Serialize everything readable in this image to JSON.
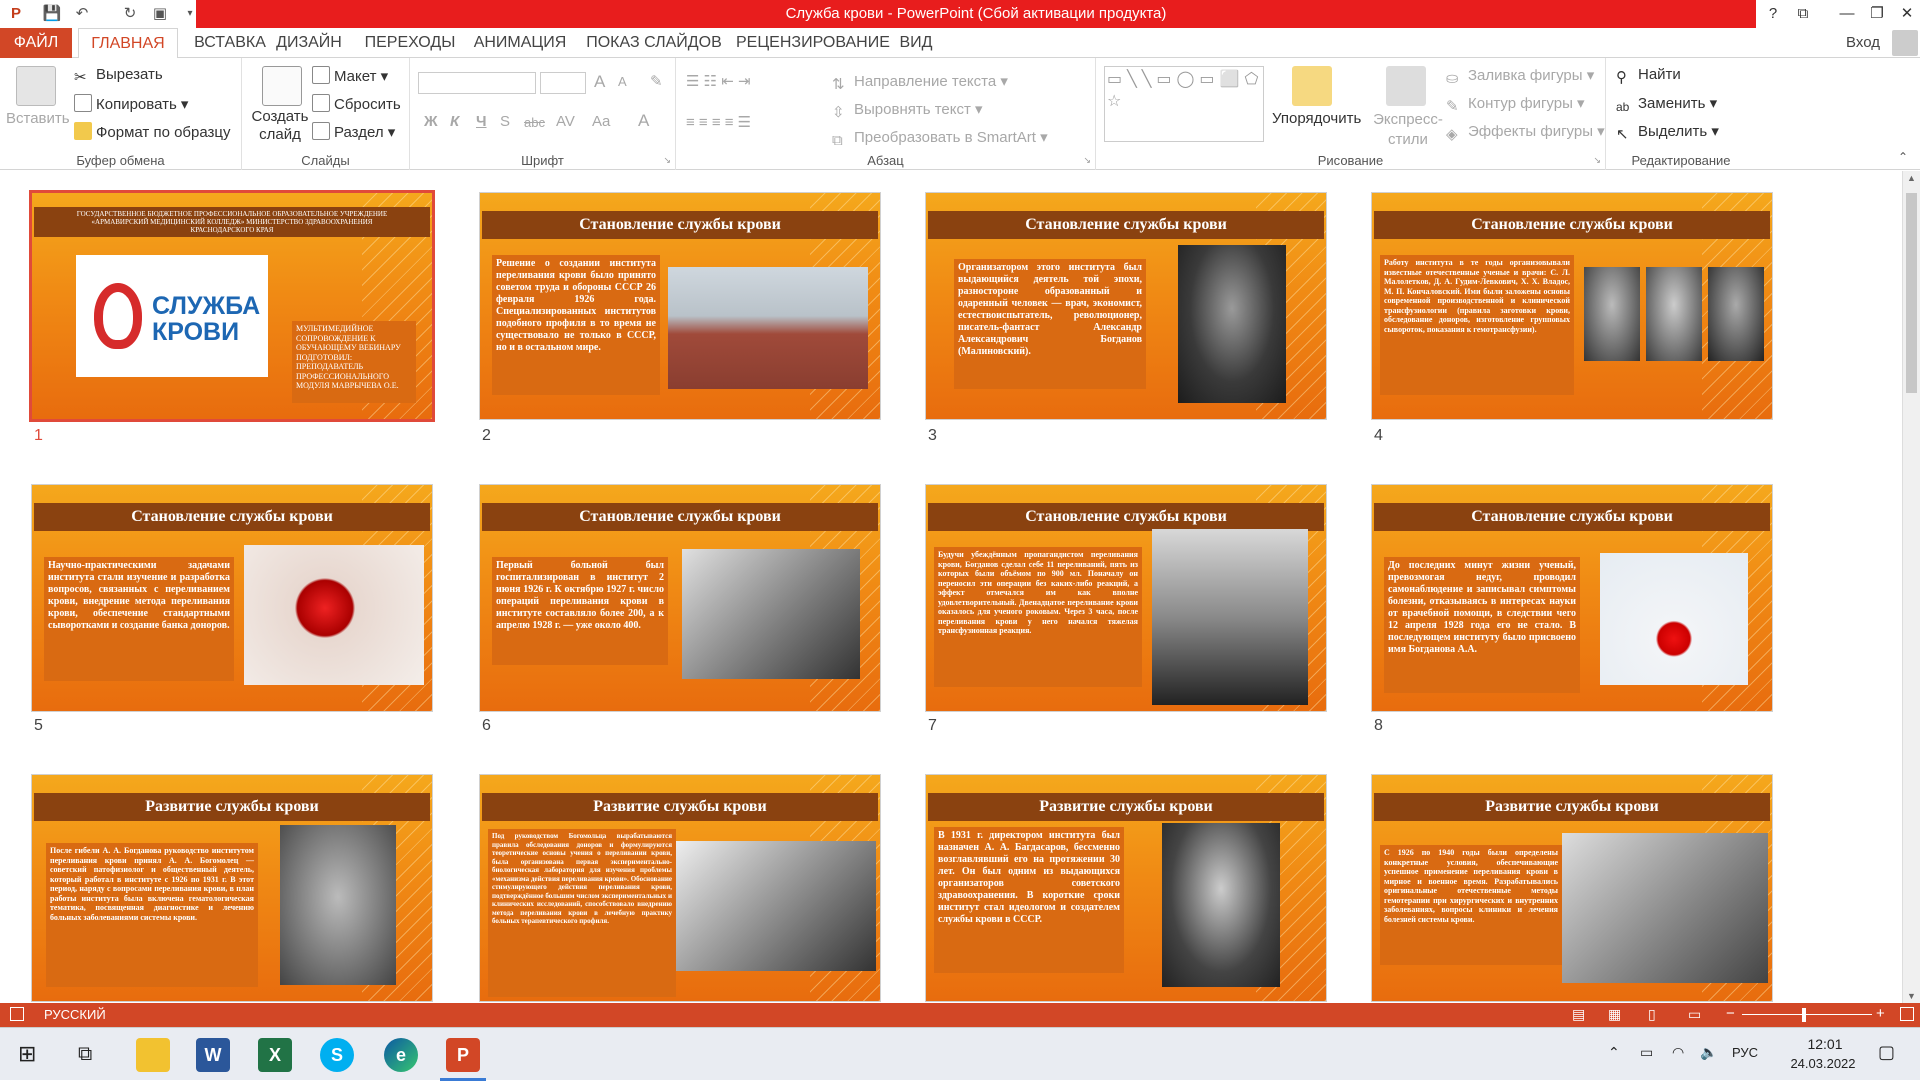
{
  "window": {
    "title": "Служба крови -  PowerPoint (Сбой активации продукта)",
    "help": "?",
    "user": "Вход"
  },
  "tabs": [
    {
      "label": "ФАЙЛ"
    },
    {
      "label": "ГЛАВНАЯ"
    },
    {
      "label": "ВСТАВКА"
    },
    {
      "label": "ДИЗАЙН"
    },
    {
      "label": "ПЕРЕХОДЫ"
    },
    {
      "label": "АНИМАЦИЯ"
    },
    {
      "label": "ПОКАЗ СЛАЙДОВ"
    },
    {
      "label": "РЕЦЕНЗИРОВАНИЕ"
    },
    {
      "label": "ВИД"
    }
  ],
  "ribbon": {
    "clipboard": {
      "label": "Буфер обмена",
      "paste": "Вставить",
      "cut": "Вырезать",
      "copy": "Копировать",
      "format_painter": "Формат по образцу"
    },
    "slides": {
      "label": "Слайды",
      "new_slide": "Создать слайд",
      "layout": "Макет",
      "reset": "Сбросить",
      "section": "Раздел"
    },
    "font": {
      "label": "Шрифт",
      "bold": "Ж",
      "italic": "К",
      "underline": "Ч",
      "shadow": "S",
      "strike": "abc",
      "spacing": "AV",
      "case": "Aa",
      "color": "A",
      "grow": "A",
      "shrink": "A"
    },
    "paragraph": {
      "label": "Абзац",
      "text_direction": "Направление текста",
      "align_text": "Выровнять текст",
      "smartart": "Преобразовать в SmartArt"
    },
    "drawing": {
      "label": "Рисование",
      "arrange": "Упорядочить",
      "quick_styles": "Экспресс-стили",
      "fill": "Заливка фигуры",
      "outline": "Контур фигуры",
      "effects": "Эффекты фигуры"
    },
    "editing": {
      "label": "Редактирование",
      "find": "Найти",
      "replace": "Заменить",
      "select": "Выделить"
    }
  },
  "slides": [
    {
      "num": "1",
      "title": "",
      "org": "ГОСУДАРСТВЕННОЕ БЮДЖЕТНОЕ ПРОФЕССИОНАЛЬНОЕ ОБРАЗОВАТЕЛЬНОЕ УЧРЕЖДЕНИЕ «АРМАВИРСКИЙ МЕДИЦИНСКИЙ КОЛЛЕДЖ» МИНИСТЕРСТВО ЗДРАВООХРАНЕНИЯ КРАСНОДАРСКОГО КРАЯ",
      "logo_line1": "СЛУЖБА",
      "logo_line2": "КРОВИ",
      "text": "МУЛЬТИМЕДИЙНОЕ СОПРОВОЖДЕНИЕ К ОБУЧАЮЩЕМУ ВЕБИНАРУ ПОДГОТОВИЛ: ПРЕПОДАВАТЕЛЬ ПРОФЕССИОНАЛЬНОГО МОДУЛЯ МАВРЫЧЕВА О.Е."
    },
    {
      "num": "2",
      "title": "Становление службы крови",
      "text": "Решение о создании института переливания крови было принято советом труда и обороны СССР 26 февраля 1926 года. Специализированных институтов подобного профиля в то время не существовало не только в СССР, но и в остальном мире."
    },
    {
      "num": "3",
      "title": "Становление службы крови",
      "text": "Организатором этого института был выдающийся деятель той эпохи, разностороне образованный и одаренный человек — врач, экономист, естествоиспытатель, революционер, писатель-фантаст Александр Александрович Богданов (Малиновский)."
    },
    {
      "num": "4",
      "title": "Становление службы крови",
      "text": "Работу института в те годы организовывали известные отечественные ученые и врачи: С. Л. Малолетков, Д. А. Гудим-Левкович, Х. Х. Владос, М. П. Кончаловский. Ими были заложены основы современной производственной и клинической трансфузиологии (правила заготовки крови, обследование доноров, изготовление групповых сывороток, показания к гемотрансфузии)."
    },
    {
      "num": "5",
      "title": "Становление службы крови",
      "text": "Научно-практическими задачами института стали изучение и разработка вопросов, связанных с переливанием крови, внедрение метода переливания крови, обеспечение стандартными сыворотками и создание банка доноров."
    },
    {
      "num": "6",
      "title": "Становление службы крови",
      "text": "Первый больной был госпитализирован в институт 2 июня 1926 г. К октябрю 1927 г. число операций переливания крови в институте составляло более 200, а к апрелю 1928 г. — уже около 400."
    },
    {
      "num": "7",
      "title": "Становление службы крови",
      "text": "Будучи убеждённым пропагандистом переливания крови, Богданов сделал себе 11 переливаний, пять из которых были объёмом по 900 мл. Поначалу он переносил эти операции без каких-либо реакций, а эффект отмечался им как вполне удовлетворительный. Двенадцатое переливание крови оказалось для ученого роковым. Через 3 часа, после переливания крови у него начался тяжелая трансфузионная реакция."
    },
    {
      "num": "8",
      "title": "Становление службы крови",
      "text": "До последних минут жизни ученый, превозмогая недуг, проводил самонаблюдение и записывал симптомы болезни, отказываясь в интересах науки от врачебной помощи, в следствии чего 12 апреля 1928 года его не стало. В последующем институту было присвоено имя Богданова А.А."
    },
    {
      "num": "9",
      "title": "Развитие службы крови",
      "text": "После гибели А. А. Богданова руководство институтом переливания крови принял А. А. Богомолец — советский патофизиолог и общественный деятель, который работал в институте с 1926 по 1931 г. В этот период, наряду с вопросами переливания крови, в план работы института была включена гематологическая тематика, посвященная диагностике и лечению больных заболеваниями системы крови."
    },
    {
      "num": "10",
      "title": "Развитие службы крови",
      "text": "Под руководством Богомольца вырабатываются правила обследования доноров и формулируются теоретические основы учения о переливании крови, была организована первая экспериментально-биологическая лаборатория для изучения проблемы «механизма действия переливания крови». Обоснование стимулирующего действия переливания крови, подтверждённое большим числом экспериментальных и клинических исследований, способствовало внедрению метода переливания крови в лечебную практику больных терапевтического профиля."
    },
    {
      "num": "11",
      "title": "Развитие службы крови",
      "text": "В 1931 г. директором института был назначен А. А. Багдасаров, бессменно возглавлявший его на протяжении 30 лет. Он был одним из выдающихся организаторов советского здравоохранения. В короткие сроки институт стал идеологом и создателем службы крови в СССР."
    },
    {
      "num": "12",
      "title": "Развитие службы крови",
      "text": "С 1926 по 1940 годы были определены конкретные условия, обеспечивающие успешное применение переливания крови в мирное и военное время. Разрабатывались оригинальные отечественные методы гемотерапии при хирургических и внутренних заболеваниях, вопросы клиники и лечения болезней системы крови."
    }
  ],
  "status": {
    "language": "РУССКИЙ"
  },
  "taskbar": {
    "lang": "РУС",
    "time": "12:01",
    "date": "24.03.2022",
    "apps": [
      "explorer-icon",
      "word-icon",
      "excel-icon",
      "skype-icon",
      "edge-icon",
      "powerpoint-icon"
    ]
  },
  "colors": {
    "accent": "#d24726",
    "title_red": "#e81d1d",
    "slide_header": "#8a4210",
    "slide_orange": "#f08a14"
  }
}
